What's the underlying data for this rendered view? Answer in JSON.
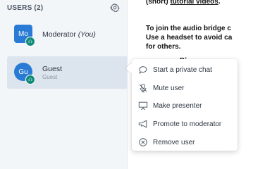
{
  "sidebar": {
    "users_title": "USERS (2)",
    "users": [
      {
        "initials": "Mo",
        "name": "Moderator",
        "role": "(You)",
        "subtitle": ""
      },
      {
        "initials": "Gu",
        "name": "Guest",
        "role": "",
        "subtitle": "Guest"
      }
    ]
  },
  "chat": {
    "line1_prefix": "(short) ",
    "line1_link": "tutorial videos",
    "line1_suffix": ".",
    "line2": "To join the audio bridge c",
    "line3": "Use a headset to avoid ca",
    "line4": "for others.",
    "line5_link": "Bi"
  },
  "menu": {
    "items": [
      {
        "label": "Start a private chat",
        "icon": "chat-bubble-icon"
      },
      {
        "label": "Mute user",
        "icon": "microphone-muted-icon"
      },
      {
        "label": "Make presenter",
        "icon": "presentation-screen-icon"
      },
      {
        "label": "Promote to moderator",
        "icon": "megaphone-icon"
      },
      {
        "label": "Remove user",
        "icon": "remove-circle-icon"
      }
    ]
  },
  "colors": {
    "avatar": "#2a7bd5",
    "voice_badge": "#0f8a78",
    "selected_row": "#dce4ed",
    "sidebar_bg": "#f3f6f9"
  }
}
